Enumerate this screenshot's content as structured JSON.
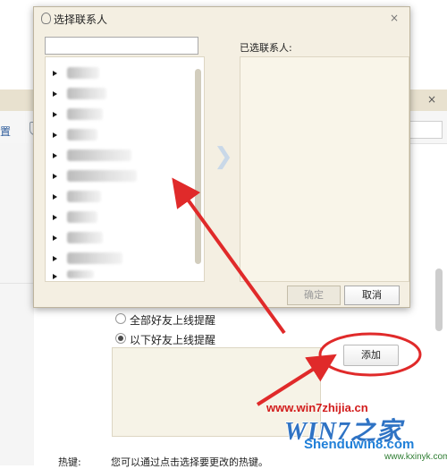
{
  "background_window": {
    "close_glyph": "×",
    "left_text": "置",
    "radio_options": [
      {
        "label": "全部好友上线提醒",
        "selected": false
      },
      {
        "label": "以下好友上线提醒",
        "selected": true
      }
    ],
    "add_button": "添加",
    "hotkey_label": "热键:",
    "hotkey_desc": "您可以通过点击选择要更改的热键。"
  },
  "dialog": {
    "title": "选择联系人",
    "close_glyph": "×",
    "selected_label": "已选联系人:",
    "transfer_glyph": "❯",
    "contact_rows": 11,
    "ok_button": "确定",
    "cancel_button": "取消"
  },
  "watermark": {
    "url": "www.win7zhijia.cn",
    "logo_text": "WIN7之家",
    "site_2": "Shenduwin8.com",
    "site_3": "www.kxinyk.com"
  },
  "colors": {
    "annotation_red": "#e02a2a",
    "dialog_bg": "#f4efe2"
  }
}
